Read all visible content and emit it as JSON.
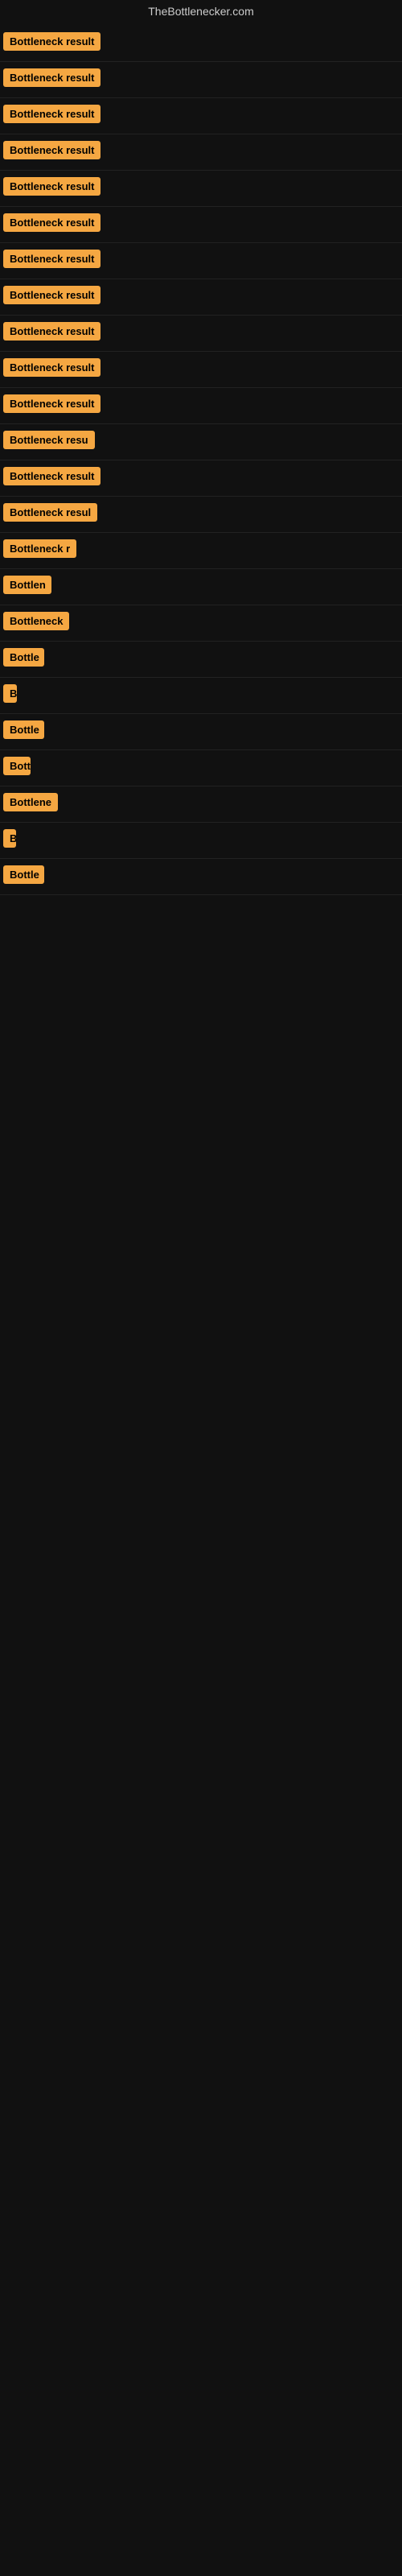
{
  "header": {
    "title": "TheBottlenecker.com"
  },
  "results": [
    {
      "id": 1,
      "label": "Bottleneck result",
      "truncated": false
    },
    {
      "id": 2,
      "label": "Bottleneck result",
      "truncated": false
    },
    {
      "id": 3,
      "label": "Bottleneck result",
      "truncated": false
    },
    {
      "id": 4,
      "label": "Bottleneck result",
      "truncated": false
    },
    {
      "id": 5,
      "label": "Bottleneck result",
      "truncated": false
    },
    {
      "id": 6,
      "label": "Bottleneck result",
      "truncated": false
    },
    {
      "id": 7,
      "label": "Bottleneck result",
      "truncated": false
    },
    {
      "id": 8,
      "label": "Bottleneck result",
      "truncated": false
    },
    {
      "id": 9,
      "label": "Bottleneck result",
      "truncated": false
    },
    {
      "id": 10,
      "label": "Bottleneck result",
      "truncated": false
    },
    {
      "id": 11,
      "label": "Bottleneck result",
      "truncated": false
    },
    {
      "id": 12,
      "label": "Bottleneck resu",
      "truncated": true
    },
    {
      "id": 13,
      "label": "Bottleneck result",
      "truncated": false
    },
    {
      "id": 14,
      "label": "Bottleneck resul",
      "truncated": true
    },
    {
      "id": 15,
      "label": "Bottleneck r",
      "truncated": true
    },
    {
      "id": 16,
      "label": "Bottlen",
      "truncated": true
    },
    {
      "id": 17,
      "label": "Bottleneck",
      "truncated": true
    },
    {
      "id": 18,
      "label": "Bottle",
      "truncated": true
    },
    {
      "id": 19,
      "label": "Bo",
      "truncated": true
    },
    {
      "id": 20,
      "label": "Bottle",
      "truncated": true
    },
    {
      "id": 21,
      "label": "Bott",
      "truncated": true
    },
    {
      "id": 22,
      "label": "Bottlene",
      "truncated": true
    },
    {
      "id": 23,
      "label": "B",
      "truncated": true
    },
    {
      "id": 24,
      "label": "Bottle",
      "truncated": true
    }
  ]
}
